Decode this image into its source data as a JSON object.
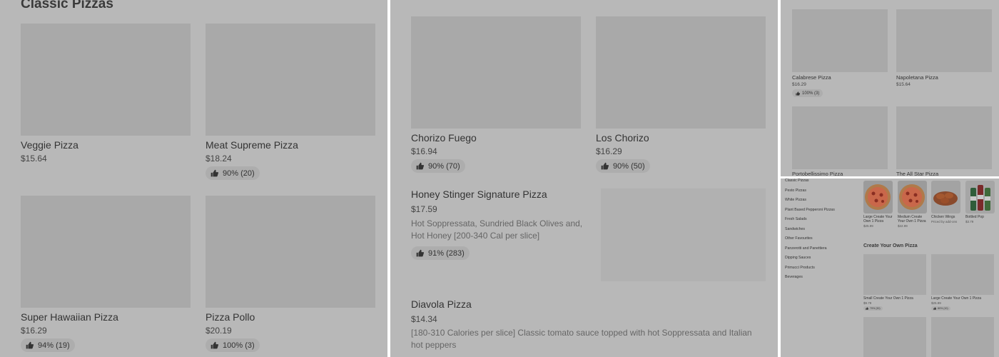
{
  "panel1": {
    "section_title": "Classic Pizzas",
    "items": [
      {
        "name": "Veggie Pizza",
        "price": "$15.64",
        "rating": ""
      },
      {
        "name": "Meat Supreme Pizza",
        "price": "$18.24",
        "rating": "90% (20)"
      },
      {
        "name": "Super Hawaiian Pizza",
        "price": "$16.29",
        "rating": "94% (19)"
      },
      {
        "name": "Pizza Pollo",
        "price": "$20.19",
        "rating": "100% (3)"
      }
    ]
  },
  "panel2": {
    "items": [
      {
        "name": "Chorizo Fuego",
        "price": "$16.94",
        "rating": "90% (70)"
      },
      {
        "name": "Los Chorizo",
        "price": "$16.29",
        "rating": "90% (50)"
      }
    ],
    "featured": [
      {
        "name": "Honey Stinger Signature Pizza",
        "price": "$17.59",
        "description": "Hot Soppressata, Sundried Black Olives and, Hot Honey [200-340 Cal per slice]",
        "rating": "91% (283)"
      },
      {
        "name": "Diavola Pizza",
        "price": "$14.34",
        "description": "[180-310 Calories per slice] Classic tomato sauce topped with hot Soppressata and Italian hot peppers",
        "rating": ""
      }
    ]
  },
  "panel3": {
    "items": [
      {
        "name": "Calabrese Pizza",
        "price": "$16.29",
        "rating": "100% (3)"
      },
      {
        "name": "Napoletana Pizza",
        "price": "$15.64",
        "rating": ""
      },
      {
        "name": "Portobellissimo Pizza",
        "price": "",
        "rating": ""
      },
      {
        "name": "The All Star Pizza",
        "price": "",
        "rating": ""
      }
    ]
  },
  "panel4": {
    "sidebar": [
      "Classic Pizzas",
      "Pesto Pizzas",
      "White Pizzas",
      "Plant Based Pepperoni Pizzas",
      "Fresh Salads",
      "Sandwiches",
      "Other Favourites",
      "Panzerotti and Panettiera",
      "Dipping Sauces",
      "Primucci Products",
      "Beverages"
    ],
    "featured": [
      {
        "name": "Large Create Your Own 1 Pizza",
        "price": "$25.99"
      },
      {
        "name": "Medium Create Your Own 1 Pizza",
        "price": "$22.99"
      },
      {
        "name": "Chicken Wings",
        "price": "Priced by add-ons"
      },
      {
        "name": "Bottled Pop",
        "price": "$3.79"
      }
    ],
    "section_title": "Create Your Own Pizza",
    "items": [
      {
        "name": "Small Create Your Own 1 Pizza",
        "price": "$9.79",
        "rating": "79% (30)"
      },
      {
        "name": "Large Create Your Own 1 Pizza",
        "price": "$25.99",
        "rating": "80% (10)"
      }
    ]
  },
  "icons": {
    "rating": "thumbs-up-icon"
  },
  "colors": {
    "overlay": "#b8b8b8",
    "card": "#a9a9a9",
    "badge": "#adadad",
    "text": "#333333"
  }
}
